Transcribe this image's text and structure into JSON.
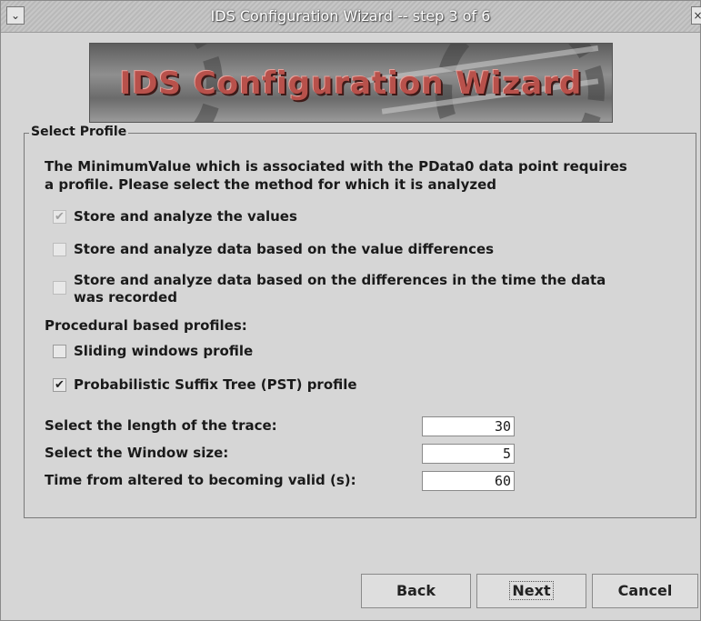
{
  "window": {
    "title": "IDS Configuration Wizard -- step 3 of 6",
    "menu_glyph": "⌄",
    "close_glyph": "×"
  },
  "banner": {
    "text": "IDS Configuration Wizard"
  },
  "profile_group": {
    "legend": "Select Profile",
    "description_line1": "The MinimumValue which is associated with the PData0 data point requires",
    "description_line2": "a profile. Please select the method for which it is analyzed",
    "options": [
      {
        "label": "Store and analyze the values",
        "checked": true,
        "enabled": false
      },
      {
        "label": "Store and analyze data based on the value differences",
        "checked": false,
        "enabled": false
      },
      {
        "label_line1": "Store and analyze data based on the differences in the time the data",
        "label_line2": "was recorded",
        "checked": false,
        "enabled": false
      }
    ],
    "procedural_heading": "Procedural based profiles:",
    "procedural_options": [
      {
        "label": "Sliding windows profile",
        "checked": false,
        "enabled": true
      },
      {
        "label": "Probabilistic Suffix Tree (PST) profile",
        "checked": true,
        "enabled": true
      }
    ],
    "fields": [
      {
        "label": "Select the length of the trace:",
        "value": "30"
      },
      {
        "label": "Select the Window size:",
        "value": "5"
      },
      {
        "label": "Time from altered to becoming valid (s):",
        "value": "60"
      }
    ]
  },
  "buttons": {
    "back": "Back",
    "next": "Next",
    "cancel": "Cancel"
  },
  "glyphs": {
    "check": "✔"
  }
}
